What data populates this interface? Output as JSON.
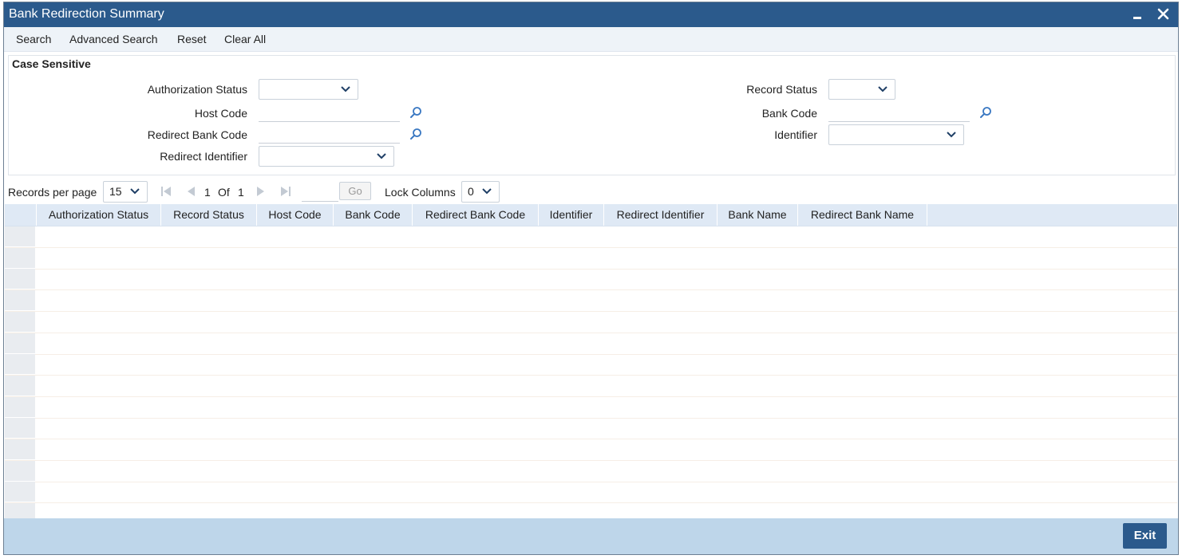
{
  "window": {
    "title": "Bank Redirection Summary",
    "minimize_icon": "minimize-icon",
    "close_icon": "close-icon"
  },
  "toolbar": {
    "items": [
      "Search",
      "Advanced Search",
      "Reset",
      "Clear All"
    ]
  },
  "criteria": {
    "legend": "Case Sensitive",
    "authorization_status": {
      "label": "Authorization Status",
      "value": ""
    },
    "record_status": {
      "label": "Record Status",
      "value": ""
    },
    "host_code": {
      "label": "Host Code",
      "value": ""
    },
    "bank_code": {
      "label": "Bank Code",
      "value": ""
    },
    "redirect_bank_code": {
      "label": "Redirect Bank Code",
      "value": ""
    },
    "identifier": {
      "label": "Identifier",
      "value": ""
    },
    "redirect_identifier": {
      "label": "Redirect Identifier",
      "value": ""
    }
  },
  "pager": {
    "records_per_page_label": "Records per page",
    "records_per_page": "15",
    "current_page": "1",
    "of_label": "Of",
    "total_pages": "1",
    "go_label": "Go",
    "lock_columns_label": "Lock Columns",
    "lock_columns": "0"
  },
  "grid": {
    "columns": [
      "Authorization Status",
      "Record Status",
      "Host Code",
      "Bank Code",
      "Redirect Bank Code",
      "Identifier",
      "Redirect Identifier",
      "Bank Name",
      "Redirect Bank Name"
    ],
    "rows": []
  },
  "footer": {
    "exit_label": "Exit"
  },
  "colors": {
    "titlebar": "#2b5a8c",
    "footer": "#bed6ea",
    "header": "#dfe9f5",
    "accent": "#2b5a8c"
  }
}
